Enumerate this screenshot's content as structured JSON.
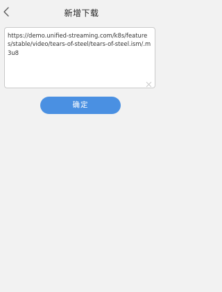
{
  "header": {
    "title": "新增下载"
  },
  "url_input": {
    "value": "https://demo.unified-streaming.com/k8s/features/stable/video/tears-of-steel/tears-of-steel.ism/.m3u8"
  },
  "confirm_button": {
    "label": "确定"
  },
  "icons": {
    "back": "chevron-left-icon",
    "clear": "close-icon"
  },
  "colors": {
    "accent": "#4a90e2",
    "background": "#f2f2f2"
  }
}
